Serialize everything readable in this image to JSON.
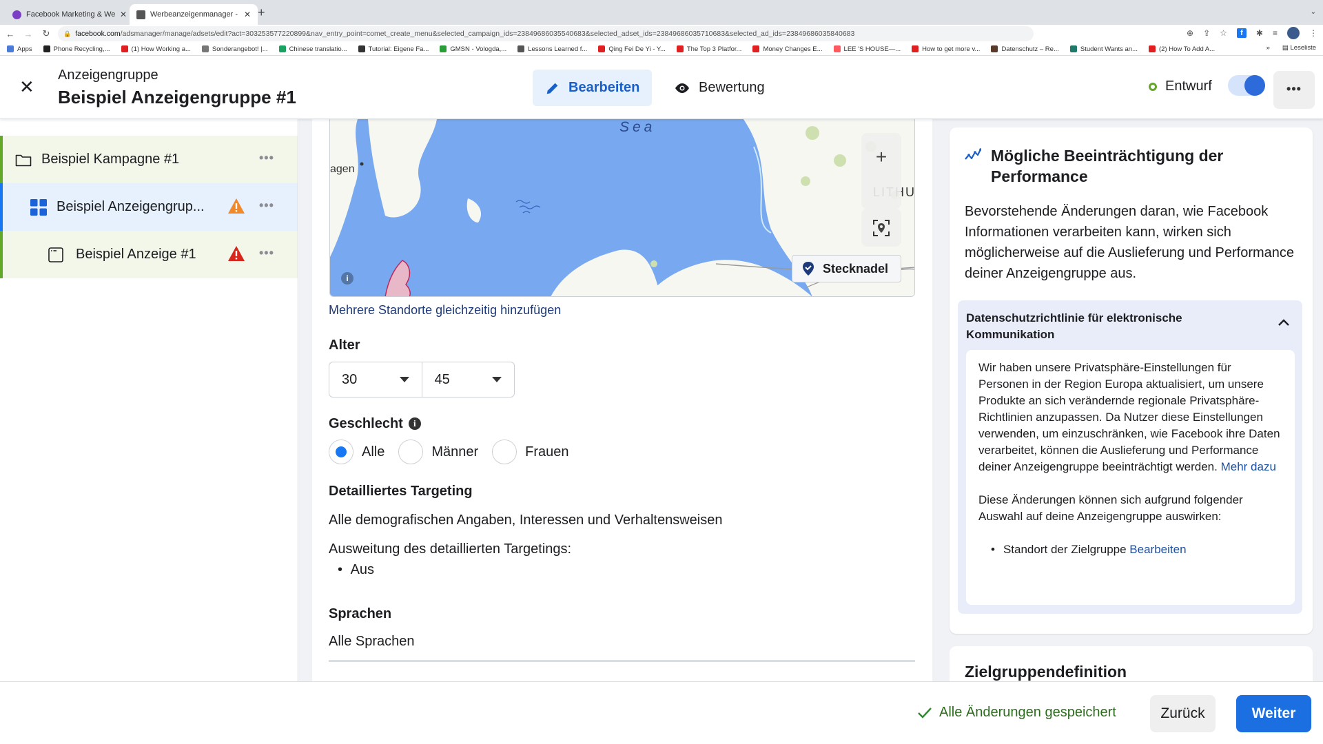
{
  "browser": {
    "tabs": [
      {
        "title": "Facebook Marketing & Werbea",
        "active": false,
        "favicon_color": "#7b3fc6"
      },
      {
        "title": "Werbeanzeigenmanager - Wer",
        "active": true,
        "favicon_color": "#555555"
      }
    ],
    "url": {
      "host": "facebook.com",
      "path": "/adsmanager/manage/adsets/edit?act=303253577220899&nav_entry_point=comet_create_menu&selected_campaign_ids=23849686035540683&selected_adset_ids=23849686035710683&selected_ad_ids=23849686035840683"
    },
    "bookmarks": [
      {
        "label": "Apps",
        "color": "#4a7bd8"
      },
      {
        "label": "Phone Recycling,...",
        "color": "#222222"
      },
      {
        "label": "(1) How Working a...",
        "color": "#e02020"
      },
      {
        "label": "Sonderangebot! |...",
        "color": "#777777"
      },
      {
        "label": "Chinese translatio...",
        "color": "#1aa260"
      },
      {
        "label": "Tutorial: Eigene Fa...",
        "color": "#333333"
      },
      {
        "label": "GMSN - Vologda,...",
        "color": "#2a9d3a"
      },
      {
        "label": "Lessons Learned f...",
        "color": "#555555"
      },
      {
        "label": "Qing Fei De Yi - Y...",
        "color": "#e02020"
      },
      {
        "label": "The Top 3 Platfor...",
        "color": "#e02020"
      },
      {
        "label": "Money Changes E...",
        "color": "#e02020"
      },
      {
        "label": "LEE 'S HOUSE—...",
        "color": "#ff5a5f"
      },
      {
        "label": "How to get more v...",
        "color": "#e02020"
      },
      {
        "label": "Datenschutz – Re...",
        "color": "#5a3a2a"
      },
      {
        "label": "Student Wants an...",
        "color": "#1f7a6a"
      },
      {
        "label": "(2) How To Add A...",
        "color": "#e02020"
      }
    ],
    "reading_list": "Leseliste",
    "more_bookmarks": "»"
  },
  "header": {
    "subtitle": "Anzeigengruppe",
    "title": "Beispiel Anzeigengruppe #1",
    "tabs": {
      "edit": "Bearbeiten",
      "review": "Bewertung"
    },
    "status": "Entwurf",
    "toggle_on": true,
    "more": "•••"
  },
  "tree": {
    "items": [
      {
        "label": "Beispiel Kampagne #1",
        "level": "campaign",
        "warning": null
      },
      {
        "label": "Beispiel Anzeigengrup...",
        "level": "adset",
        "warning": "orange"
      },
      {
        "label": "Beispiel Anzeige #1",
        "level": "ad",
        "warning": "red"
      }
    ],
    "more": "•••"
  },
  "map": {
    "sea_label": "Sea",
    "city_label": "agen",
    "country_label": "LITHU",
    "pin_button": "Stecknadel",
    "zoom_in": "+",
    "info": "i"
  },
  "form": {
    "add_multiple_link": "Mehrere Standorte gleichzeitig hinzufügen",
    "age": {
      "label": "Alter",
      "min": "30",
      "max": "45"
    },
    "gender": {
      "label": "Geschlecht",
      "options": [
        "Alle",
        "Männer",
        "Frauen"
      ],
      "selected": "Alle"
    },
    "detailed_targeting": {
      "label": "Detailliertes Targeting",
      "value": "Alle demografischen Angaben, Interessen und Verhaltensweisen",
      "expansion_label": "Ausweitung des detaillierten Targetings:",
      "expansion_value": "Aus"
    },
    "languages": {
      "label": "Sprachen",
      "value": "Alle Sprachen"
    }
  },
  "right_panel": {
    "title": "Mögliche Beeinträchtigung der Performance",
    "body": "Bevorstehende Änderungen daran, wie Facebook Informationen verarbeiten kann, wirken sich möglicherweise auf die Auslieferung und Performance deiner Anzeigengruppe aus.",
    "accordion": {
      "title": "Datenschutzrichtlinie für elektronische Kommunikation",
      "paragraph1": "Wir haben unsere Privatsphäre-Einstellungen für Personen in der Region Europa aktualisiert, um unsere Produkte an sich verändernde regionale Privatsphäre-Richtlinien anzupassen. Da Nutzer diese Einstellungen verwenden, um einzuschränken, wie Facebook ihre Daten verarbeitet, können die Auslieferung und Performance deiner Anzeigengruppe beeinträchtigt werden.",
      "more_link": "Mehr dazu",
      "paragraph2": "Diese Änderungen können sich aufgrund folgender Auswahl auf deine Anzeigengruppe auswirken:",
      "list_item": "Standort der Zielgruppe",
      "list_link": "Bearbeiten"
    },
    "next_card_title": "Zielgruppendefinition"
  },
  "footer": {
    "saved": "Alle Änderungen gespeichert",
    "back": "Zurück",
    "next": "Weiter"
  },
  "colors": {
    "accent": "#1877f2",
    "edit_tab_bg": "#e7f0fd",
    "status_green": "#63a828",
    "warning_orange": "#f0892b",
    "warning_red": "#d8261c"
  }
}
